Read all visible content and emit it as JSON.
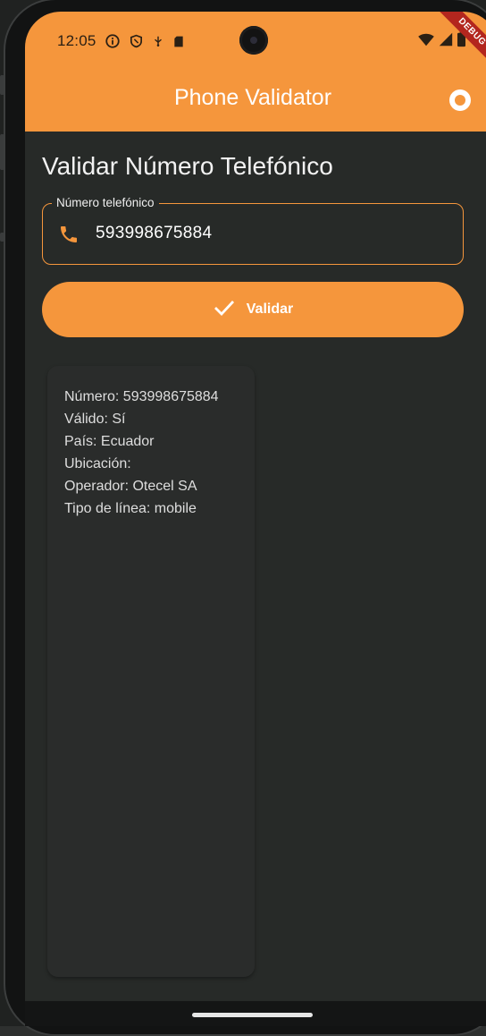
{
  "status_bar": {
    "time": "12:05",
    "icons_left": [
      "info-icon",
      "shield-icon",
      "usb-icon",
      "sd-card-icon"
    ],
    "icons_right": [
      "wifi-icon",
      "signal-icon",
      "battery-icon"
    ],
    "debug_banner": "DEBUG"
  },
  "app_bar": {
    "title": "Phone Validator",
    "action_icon": "toggle-icon",
    "color": "#f5963c"
  },
  "main": {
    "page_title": "Validar Número Telefónico",
    "phone_field": {
      "label": "Número telefónico",
      "value": "593998675884",
      "icon": "phone-icon"
    },
    "validate_button": {
      "label": "Validar",
      "icon": "check-icon"
    },
    "result": {
      "lines": [
        "Número: 593998675884",
        "Válido: Sí",
        "País: Ecuador",
        "Ubicación:",
        "Operador: Otecel SA",
        "Tipo de línea: mobile"
      ]
    }
  }
}
